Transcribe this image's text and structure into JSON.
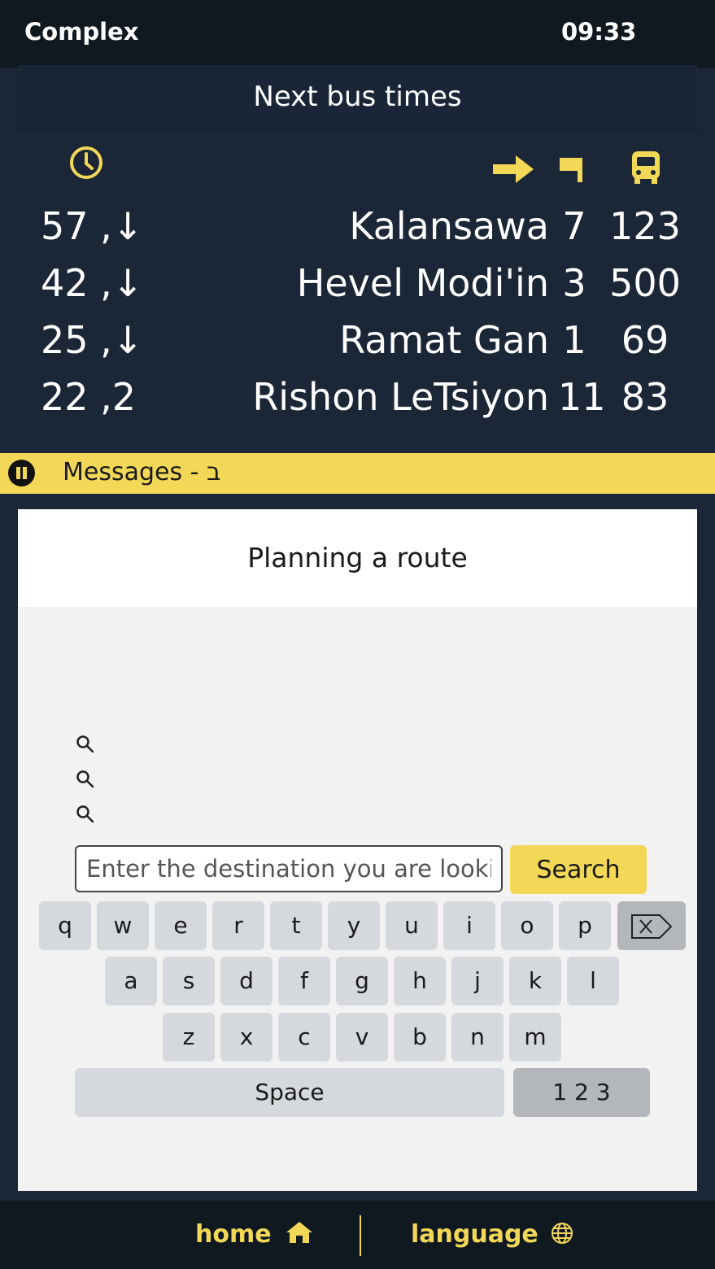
{
  "header": {
    "title": "Complex",
    "clock": "09:33"
  },
  "bus_panel": {
    "title": "Next bus times",
    "icons": {
      "time": "clock-icon",
      "destination": "arrow-right-icon",
      "platform": "flag-icon",
      "line": "bus-icon"
    },
    "rows": [
      {
        "time": "57 ,↓",
        "destination": "Kalansawa",
        "platform": "7",
        "line": "123"
      },
      {
        "time": "42 ,↓",
        "destination": "Hevel Modi'in",
        "platform": "3",
        "line": "500"
      },
      {
        "time": "25 ,↓",
        "destination": "Ramat Gan",
        "platform": "1",
        "line": "69"
      },
      {
        "time": "22 ,2",
        "destination": "Rishon LeTsiyon",
        "platform": "11",
        "line": "83"
      }
    ]
  },
  "ticker": {
    "text": "Messages - ב",
    "icon": "pause-icon"
  },
  "route": {
    "title": "Planning a route",
    "suggestion_icons": [
      "search-icon",
      "search-icon",
      "search-icon"
    ],
    "search": {
      "placeholder": "Enter the destination you are looking for",
      "value": "",
      "button": "Search"
    }
  },
  "keyboard": {
    "row1": [
      "q",
      "w",
      "e",
      "r",
      "t",
      "y",
      "u",
      "i",
      "o",
      "p"
    ],
    "row2": [
      "a",
      "s",
      "d",
      "f",
      "g",
      "h",
      "j",
      "k",
      "l"
    ],
    "row3": [
      "z",
      "x",
      "c",
      "v",
      "b",
      "n",
      "m"
    ],
    "backspace_icon": "backspace-icon",
    "space": "Space",
    "numbers": "1 2 3"
  },
  "footer": {
    "home": "home",
    "home_icon": "home-icon",
    "language": "language",
    "language_icon": "globe-icon"
  },
  "colors": {
    "accent": "#f3d858",
    "background": "#1b2636",
    "bar": "#101820",
    "key": "#d5d8dc"
  }
}
